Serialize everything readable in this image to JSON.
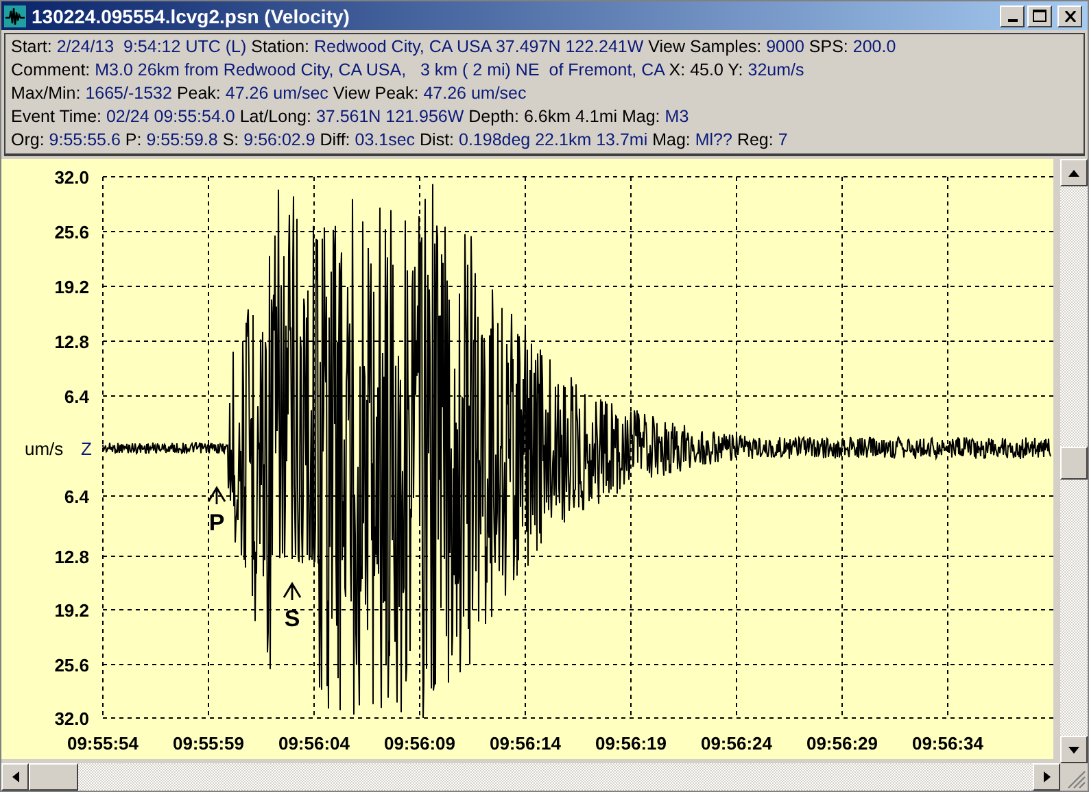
{
  "window": {
    "title": "130224.095554.lcvg2.psn (Velocity)"
  },
  "info_lines": [
    [
      {
        "label": "Start:",
        "value": "2/24/13  9:54:12 UTC (L)"
      },
      {
        "label": "Station:",
        "value": "Redwood City, CA USA 37.497N 122.241W"
      },
      {
        "label": "View Samples:",
        "value": "9000"
      },
      {
        "label": "SPS:",
        "value": "200.0"
      }
    ],
    [
      {
        "label": "Comment:",
        "value": "M3.0 26km from Redwood City, CA USA,   3 km ( 2 mi) NE  of Fremont, CA"
      },
      {
        "label": "X: 45.0 Y:",
        "value": "32um/s"
      }
    ],
    [
      {
        "label": "Max/Min:",
        "value": "1665/-1532"
      },
      {
        "label": "Peak:",
        "value": "47.26 um/sec"
      },
      {
        "label": "View Peak:",
        "value": "47.26 um/sec"
      }
    ],
    [
      {
        "label": "Event Time:",
        "value": "02/24 09:55:54.0"
      },
      {
        "label": "Lat/Long:",
        "value": "37.561N 121.956W"
      },
      {
        "label": "Depth: 6.6km 4.1mi Mag:",
        "value": "M3"
      }
    ],
    [
      {
        "label": "Org:",
        "value": "9:55:55.6"
      },
      {
        "label": "P:",
        "value": "9:55:59.8"
      },
      {
        "label": "S:",
        "value": "9:56:02.9"
      },
      {
        "label": "Diff:",
        "value": "03.1sec"
      },
      {
        "label": "Dist:",
        "value": "0.198deg 22.1km 13.7mi"
      },
      {
        "label": "Mag:",
        "value": "Ml??"
      },
      {
        "label": "Reg:",
        "value": "7"
      }
    ]
  ],
  "plot": {
    "unit": "um/s",
    "component": "Z",
    "y_labels_upper": [
      "32.0",
      "25.6",
      "19.2",
      "12.8",
      "6.4"
    ],
    "y_labels_lower": [
      "6.4",
      "12.8",
      "19.2",
      "25.6",
      "32.0"
    ],
    "x_labels": [
      "09:55:54",
      "09:55:59",
      "09:56:04",
      "09:56:09",
      "09:56:14",
      "09:56:19",
      "09:56:24",
      "09:56:29",
      "09:56:34"
    ],
    "phases": [
      {
        "label": "P"
      },
      {
        "label": "S"
      }
    ]
  }
}
